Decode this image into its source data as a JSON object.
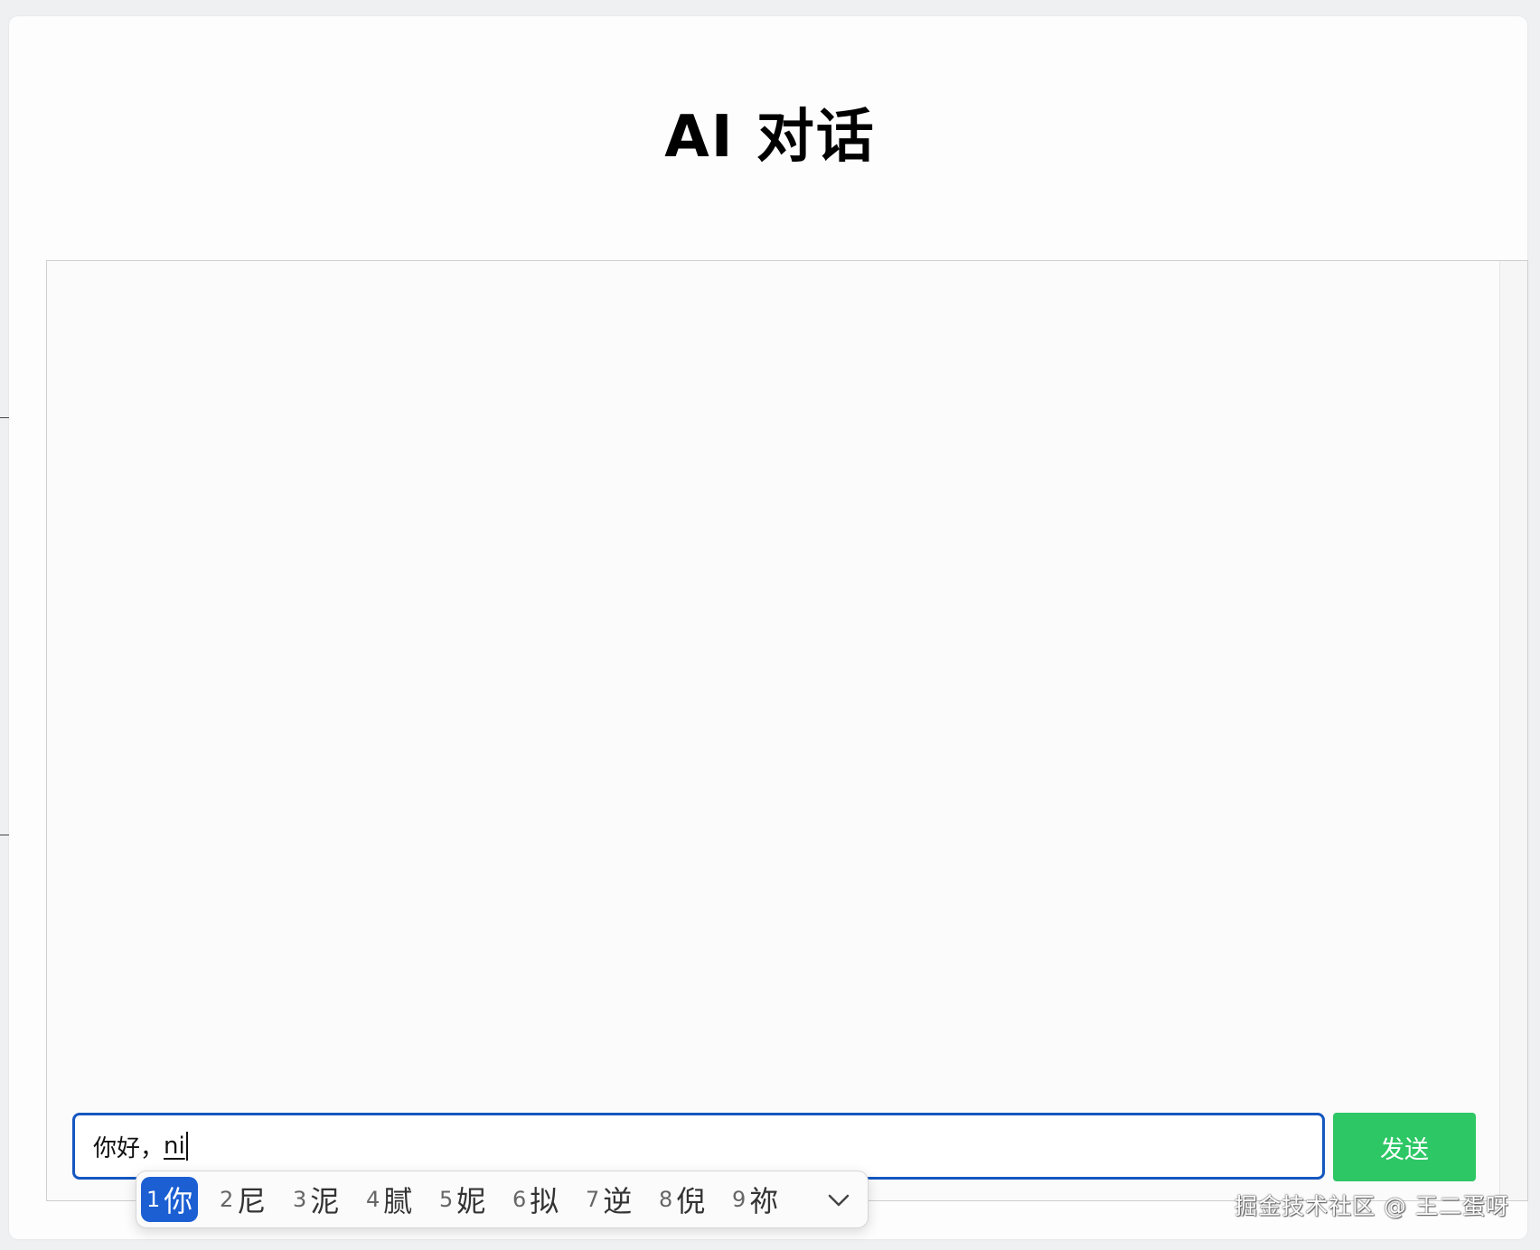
{
  "page": {
    "title": "AI 对话"
  },
  "input": {
    "committed": "你好，",
    "composing": "ni"
  },
  "send_button": {
    "label": "发送"
  },
  "ime": {
    "candidates": [
      {
        "num": "1",
        "char": "你",
        "selected": true
      },
      {
        "num": "2",
        "char": "尼"
      },
      {
        "num": "3",
        "char": "泥"
      },
      {
        "num": "4",
        "char": "腻"
      },
      {
        "num": "5",
        "char": "妮"
      },
      {
        "num": "6",
        "char": "拟"
      },
      {
        "num": "7",
        "char": "逆"
      },
      {
        "num": "8",
        "char": "倪"
      },
      {
        "num": "9",
        "char": "祢"
      }
    ],
    "expand_icon": "chevron-down-icon"
  },
  "watermark": "掘金技术社区 @ 王二蛋呀",
  "colors": {
    "input_border": "#1557c0",
    "send_button": "#2ec766",
    "ime_selected": "#1b5fd3"
  }
}
